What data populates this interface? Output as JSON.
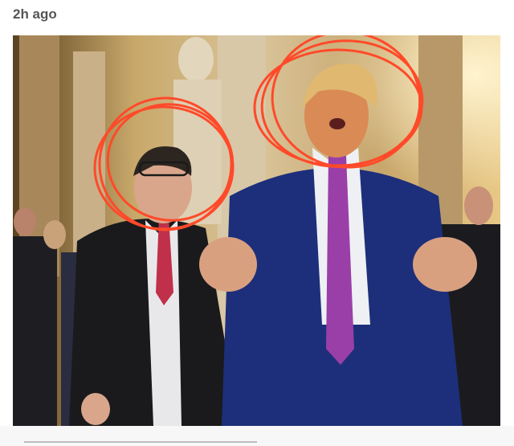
{
  "post": {
    "timestamp": "2h ago"
  },
  "photo": {
    "annotation_color": "#ff4a2a"
  }
}
